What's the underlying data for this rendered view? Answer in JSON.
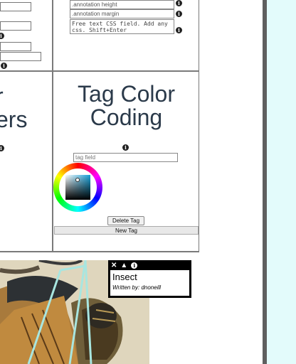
{
  "left_panel": {
    "heading_line1": "r",
    "heading_line2": "ers"
  },
  "css_panel": {
    "annotation_height_placeholder": ".annotation height",
    "annotation_margin_placeholder": ".annotation margin",
    "free_css_placeholder": "Free text CSS field. Add any css. Shift+Enter"
  },
  "tag_panel": {
    "title_line1": "Tag Color",
    "title_line2": "Coding",
    "tag_field_placeholder": "tag field",
    "delete_button": "Delete Tag",
    "new_button": "New Tag",
    "picked_color": "#1aa0d8"
  },
  "annotation": {
    "title": "Insect",
    "author_line": "Written by: dnoneill",
    "controls": [
      "close-icon",
      "collapse-icon",
      "info-icon"
    ]
  },
  "colors": {
    "right_background": "#e3fbfb",
    "heading_color": "#2b3a4a",
    "tooltip_bg": "#000000",
    "annotation_outline": "#a8e6e0"
  }
}
